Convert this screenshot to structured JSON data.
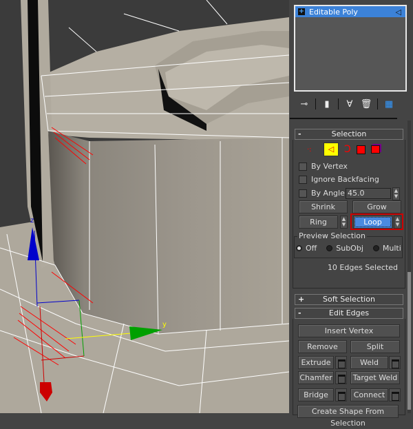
{
  "modifier_stack": {
    "items": [
      {
        "label": "Editable Poly",
        "expand": "+",
        "icon": "edge-subobject-icon"
      }
    ]
  },
  "toolbar": {
    "icons": [
      "pin-stack-icon",
      "show-end-result-icon",
      "make-unique-icon",
      "remove-modifier-icon",
      "configure-modifier-sets-icon"
    ]
  },
  "selection": {
    "header": "Selection",
    "collapse": "-",
    "subobject_modes": [
      "vertex",
      "edge",
      "border",
      "polygon",
      "element"
    ],
    "active_mode": "edge",
    "by_vertex": "By Vertex",
    "ignore_backfacing": "Ignore Backfacing",
    "by_angle": "By Angle:",
    "angle_value": "45.0",
    "shrink": "Shrink",
    "grow": "Grow",
    "ring": "Ring",
    "loop": "Loop",
    "preview": {
      "title": "Preview Selection",
      "options": [
        "Off",
        "SubObj",
        "Multi"
      ],
      "selected": "Off"
    },
    "status": "10 Edges Selected"
  },
  "soft_selection": {
    "header": "Soft Selection",
    "expand": "+"
  },
  "edit_edges": {
    "header": "Edit Edges",
    "collapse": "-",
    "insert_vertex": "Insert Vertex",
    "remove": "Remove",
    "split": "Split",
    "extrude": "Extrude",
    "weld": "Weld",
    "chamfer": "Chamfer",
    "target_weld": "Target Weld",
    "bridge": "Bridge",
    "connect": "Connect",
    "create_shape": "Create Shape From Selection"
  },
  "gizmo": {
    "z_label": "z",
    "y_label": "y"
  },
  "colors": {
    "highlight": "#3c82d8",
    "active_mode_bg": "#ffff00",
    "loop_outline": "#cc0000",
    "selected_edge": "#ff0000",
    "axis_x": "#cc0000",
    "axis_y": "#00a000",
    "axis_z": "#0000cc"
  }
}
